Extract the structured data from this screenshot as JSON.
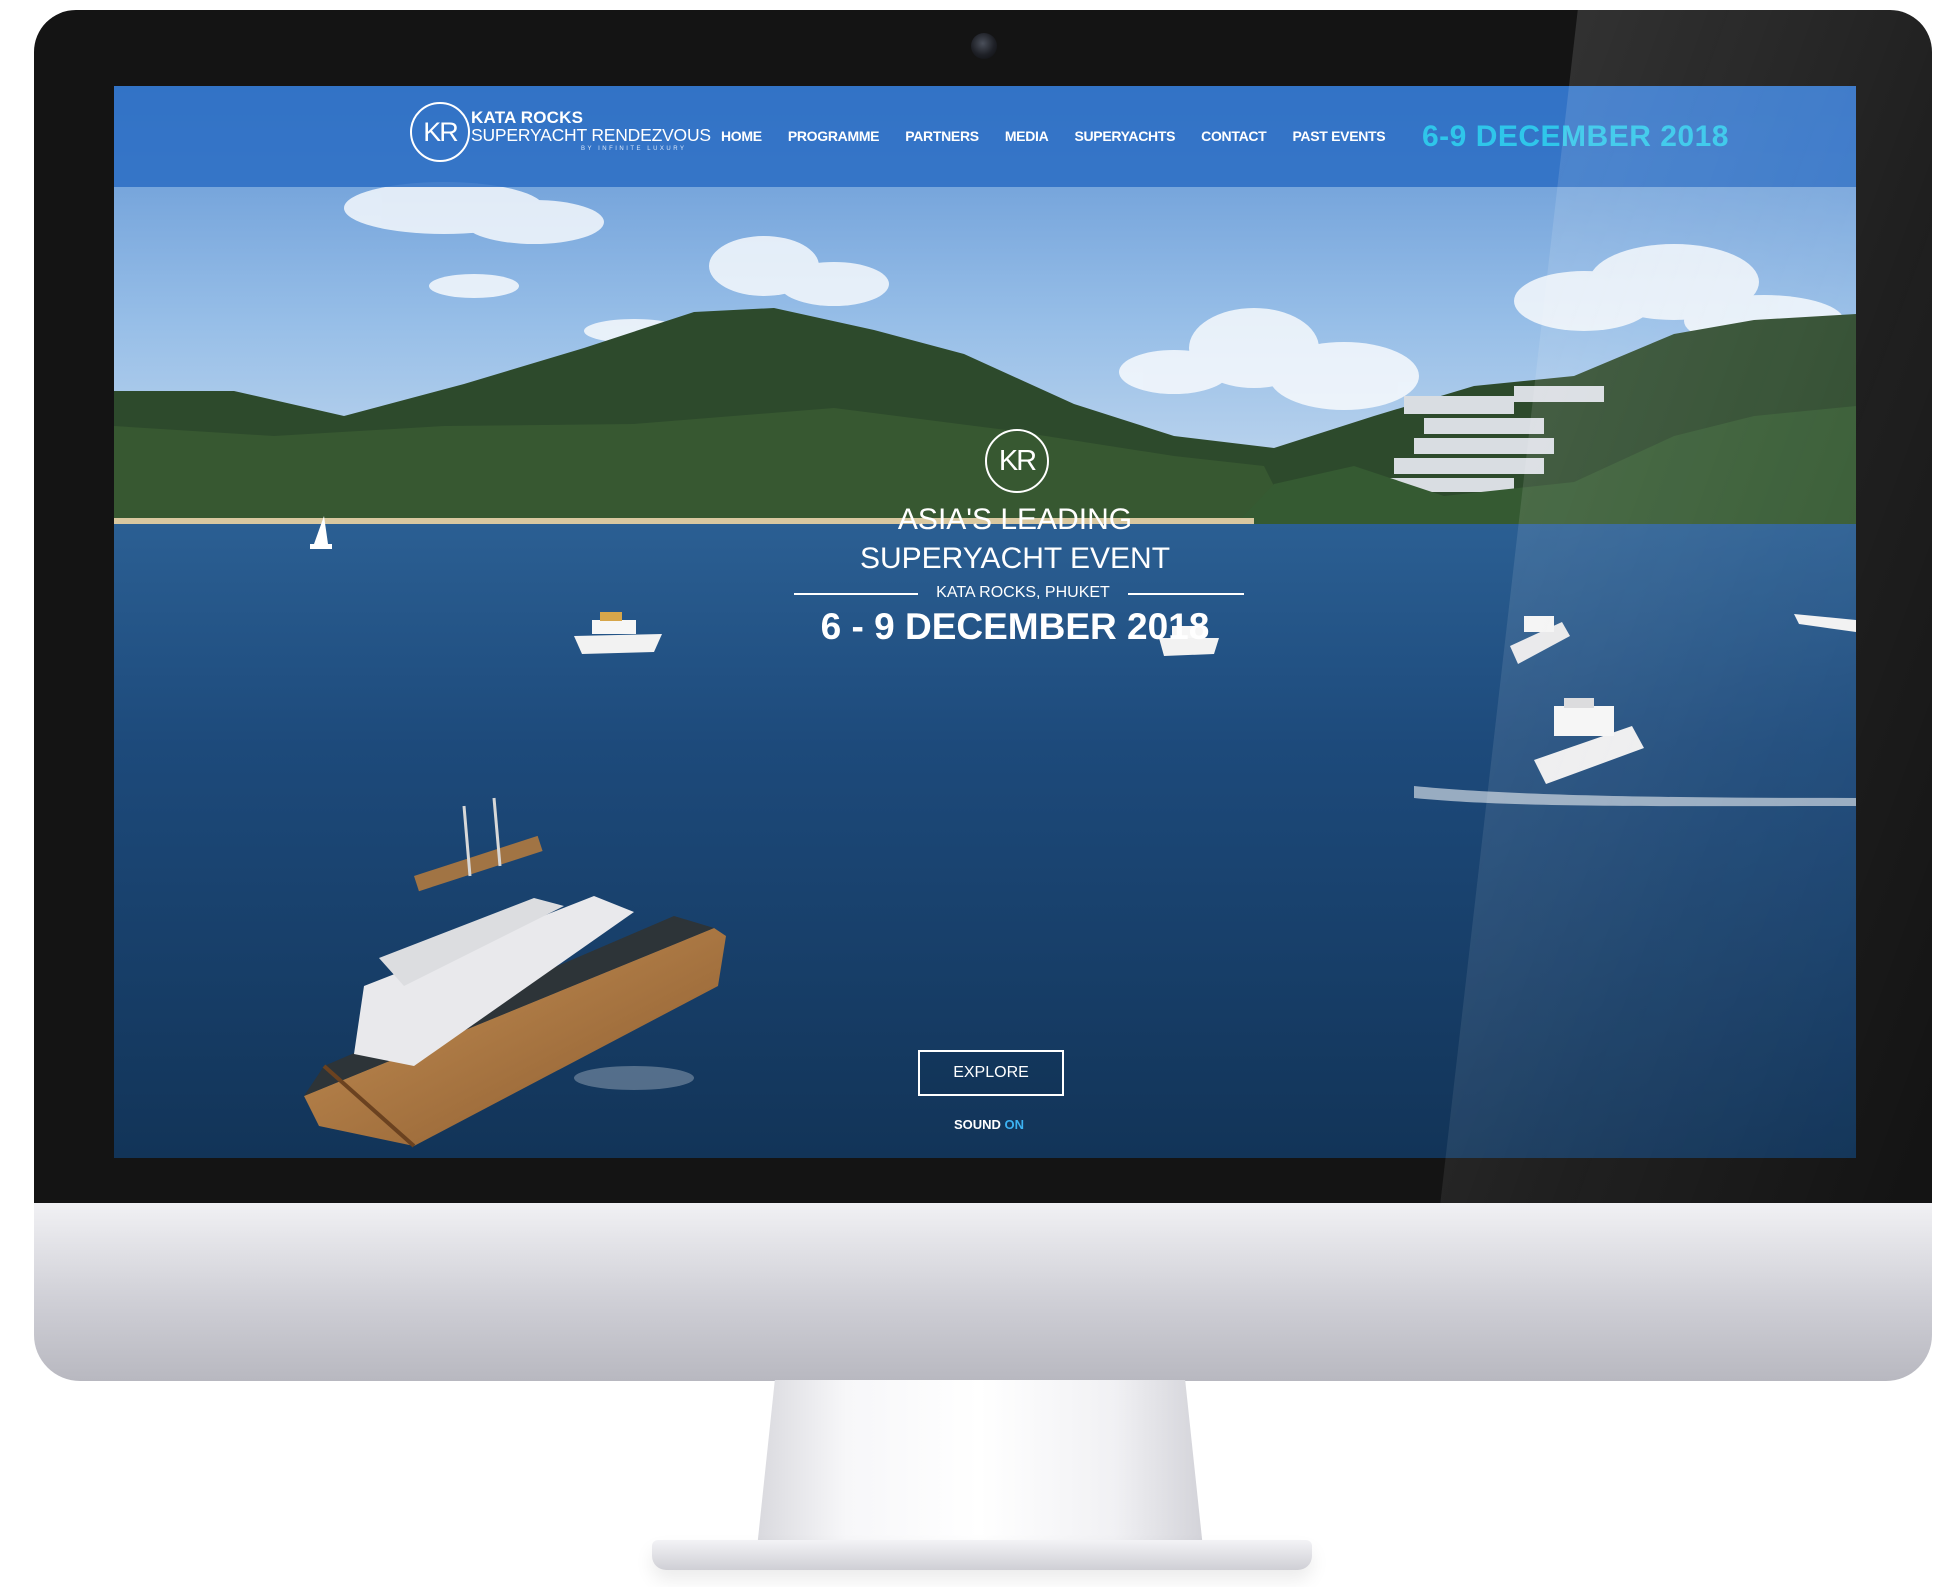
{
  "site": {
    "logo_monogram": "KR",
    "logo_line1": "KATA ROCKS",
    "logo_line2": "SUPERYACHT RENDEZVOUS",
    "logo_line3": "BY INFINITE LUXURY"
  },
  "nav": {
    "items": [
      {
        "label": "HOME"
      },
      {
        "label": "PROGRAMME"
      },
      {
        "label": "PARTNERS"
      },
      {
        "label": "MEDIA"
      },
      {
        "label": "SUPERYACHTS"
      },
      {
        "label": "CONTACT"
      },
      {
        "label": "PAST EVENTS"
      }
    ],
    "date": "6-9 DECEMBER 2018"
  },
  "hero": {
    "monogram": "KR",
    "title_line1": "ASIA'S LEADING",
    "title_line2": "SUPERYACHT EVENT",
    "location": "KATA ROCKS, PHUKET",
    "dates": "6 - 9 DECEMBER 2018",
    "explore_label": "EXPLORE",
    "sound_label": "SOUND",
    "sound_state": "ON"
  },
  "colors": {
    "navbar": "#2b6ec4",
    "nav_date": "#2fc6ea",
    "sound_on": "#3cb2f2",
    "sea": "#1a4572"
  }
}
